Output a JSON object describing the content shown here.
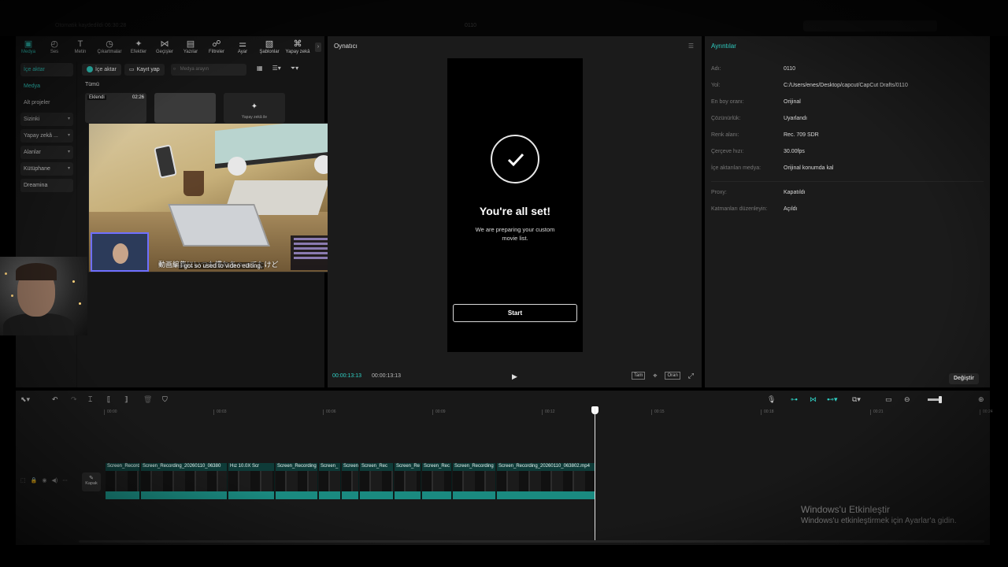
{
  "topbar": {
    "project_info": "Otomatik kaydedildi 06:30:28",
    "project_name": "0110"
  },
  "tool_tabs": [
    {
      "label": "Medya",
      "icon": "media-icon",
      "glyph": "▣"
    },
    {
      "label": "Ses",
      "icon": "audio-icon",
      "glyph": "◴"
    },
    {
      "label": "Metin",
      "icon": "text-icon",
      "glyph": "T"
    },
    {
      "label": "Çıkartmalar",
      "icon": "sticker-icon",
      "glyph": "◷"
    },
    {
      "label": "Efektler",
      "icon": "effects-icon",
      "glyph": "✦"
    },
    {
      "label": "Geçişler",
      "icon": "transitions-icon",
      "glyph": "⋈"
    },
    {
      "label": "Yazılar",
      "icon": "captions-icon",
      "glyph": "▤"
    },
    {
      "label": "Filtreler",
      "icon": "filters-icon",
      "glyph": "☍"
    },
    {
      "label": "Ayar",
      "icon": "adjust-icon",
      "glyph": "⚌"
    },
    {
      "label": "Şablonlar",
      "icon": "templates-icon",
      "glyph": "▧"
    },
    {
      "label": "Yapay zekâ",
      "icon": "ai-icon",
      "glyph": "⌘"
    }
  ],
  "media_sidebar": [
    {
      "label": "İçe aktar",
      "style": "active",
      "caret": ""
    },
    {
      "label": "Medya",
      "style": "sub",
      "caret": ""
    },
    {
      "label": "Alt projeler",
      "style": "",
      "caret": ""
    },
    {
      "label": "Sizinki",
      "style": "boxed",
      "caret": "▾"
    },
    {
      "label": "Yapay zekâ ...",
      "style": "boxed",
      "caret": "▾"
    },
    {
      "label": "Alanlar",
      "style": "boxed",
      "caret": "▾"
    },
    {
      "label": "Kütüphane",
      "style": "boxed",
      "caret": "▾"
    },
    {
      "label": "Dreamina",
      "style": "boxed",
      "caret": ""
    }
  ],
  "media": {
    "import_label": "İçe aktar",
    "record_label": "Kayıt yap",
    "search_placeholder": "Medya arayın",
    "filter_all": "Tümü",
    "thumb1_badge": "Eklendi",
    "thumb1_duration": "02:26",
    "thumb3_label": "Yapay zekâ ile"
  },
  "overlay_video": {
    "subtitle_jp": "動画編集にいつも慣れちゃってたけど",
    "subtitle_en": "I got so used to video editing,"
  },
  "player": {
    "title": "Oynatıcı",
    "ready_title": "You're all set!",
    "ready_sub": "We are preparing your custom movie list.",
    "start_label": "Start",
    "time_current": "00:00:13:13",
    "time_total": "00:00:13:13",
    "btn_full": "Tam",
    "btn_ratio": "Oran"
  },
  "details": {
    "title": "Ayrıntılar",
    "rows": [
      {
        "k": "Adı:",
        "v": "0110"
      },
      {
        "k": "Yol:",
        "v": "C:/Users/enes/Desktop/capcut/CapCut Drafts/0110"
      },
      {
        "k": "En boy oranı:",
        "v": "Orijinal"
      },
      {
        "k": "Çözünürlük:",
        "v": "Uyarlandı"
      },
      {
        "k": "Renk alanı:",
        "v": "Rec. 709 SDR"
      },
      {
        "k": "Çerçeve hızı:",
        "v": "30.00fps"
      },
      {
        "k": "İçe aktarılan medya:",
        "v": "Orijinal konumda kal"
      },
      {
        "k": "Proxy:",
        "v": "Kapatıldı"
      },
      {
        "k": "Katmanları düzenleyin:",
        "v": "Açıldı"
      }
    ],
    "change_label": "Değiştir"
  },
  "timeline": {
    "ticks": [
      "00:00",
      "00:03",
      "00:06",
      "00:09",
      "00:12",
      "00:15",
      "00:18",
      "00:21",
      "00:24"
    ],
    "cover_label": "Kapak",
    "clips": [
      {
        "name": "Screen_Record"
      },
      {
        "name": "Screen_Recording_20260110_06380"
      },
      {
        "name": "Hız 10.0X  Scr"
      },
      {
        "name": "Screen_Recording"
      },
      {
        "name": "Screen_"
      },
      {
        "name": "Screen"
      },
      {
        "name": "Screen_Rec"
      },
      {
        "name": "Screen_Re"
      },
      {
        "name": "Screen_Rec"
      },
      {
        "name": "Screen_Recording"
      },
      {
        "name": "Screen_Recording_20260110_063802.mp4"
      }
    ]
  },
  "windows_activation": {
    "title": "Windows'u Etkinleştir",
    "subtitle": "Windows'u etkinleştirmek için Ayarlar'a gidin."
  },
  "colors": {
    "accent": "#30d0c4",
    "clip_bg": "#0e3b38",
    "clip_strip": "#1a8a80"
  }
}
